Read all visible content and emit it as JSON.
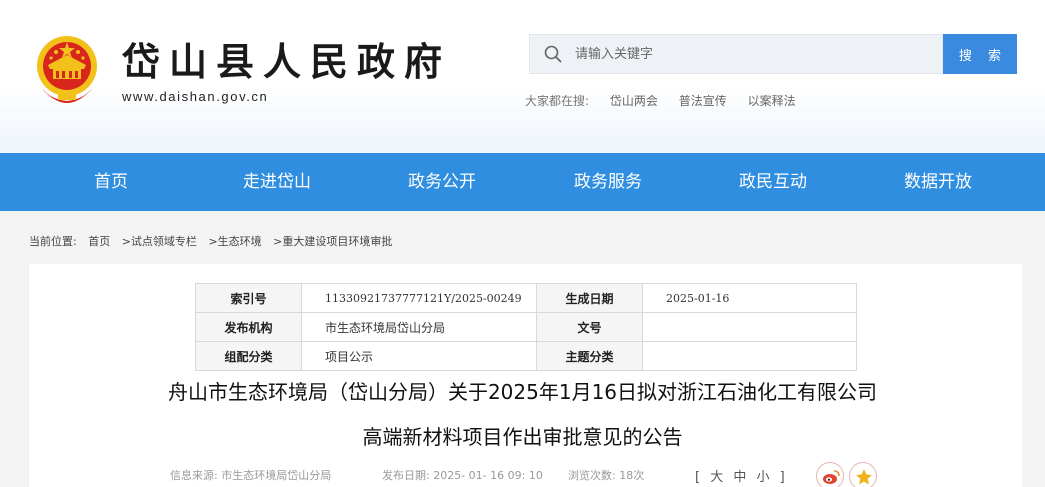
{
  "site": {
    "title": "岱山县人民政府",
    "url": "www.daishan.gov.cn"
  },
  "search": {
    "placeholder": "请输入关键字",
    "button": "搜 索"
  },
  "hot": {
    "label": "大家都在搜:",
    "links": [
      "岱山两会",
      "普法宣传",
      "以案释法"
    ]
  },
  "nav": [
    "首页",
    "走进岱山",
    "政务公开",
    "政务服务",
    "政民互动",
    "数据开放"
  ],
  "breadcrumb": {
    "label": "当前位置:",
    "items": [
      "首页",
      ">试点领域专栏",
      ">生态环境",
      ">重大建设项目环境审批"
    ]
  },
  "meta": {
    "index_label": "索引号",
    "index_value": "11330921737777121Y/2025-00249",
    "date_label": "生成日期",
    "date_value": "2025-01-16",
    "org_label": "发布机构",
    "org_value": "市生态环境局岱山分局",
    "docno_label": "文号",
    "docno_value": "",
    "category_label": "组配分类",
    "category_value": "项目公示",
    "topic_label": "主题分类",
    "topic_value": ""
  },
  "article": {
    "title_line1": "舟山市生态环境局（岱山分局）关于2025年1月16日拟对浙江石油化工有限公司",
    "title_line2": "高端新材料项目作出审批意见的公告",
    "source": "信息来源:  市生态环境局岱山分局",
    "publish": "发布日期:  2025- 01- 16 09: 10",
    "views": "浏览次数:  18次",
    "font_size": "[ 大 中 小 ]"
  },
  "colors": {
    "nav_bg": "#2f8ee0",
    "search_btn": "#3a8be0",
    "emblem_red": "#d9261c",
    "emblem_gold": "#f2c11a"
  },
  "icons": {
    "emblem": "national-emblem-icon",
    "search": "search-icon",
    "weibo": "weibo-icon",
    "favorite": "star-icon"
  }
}
